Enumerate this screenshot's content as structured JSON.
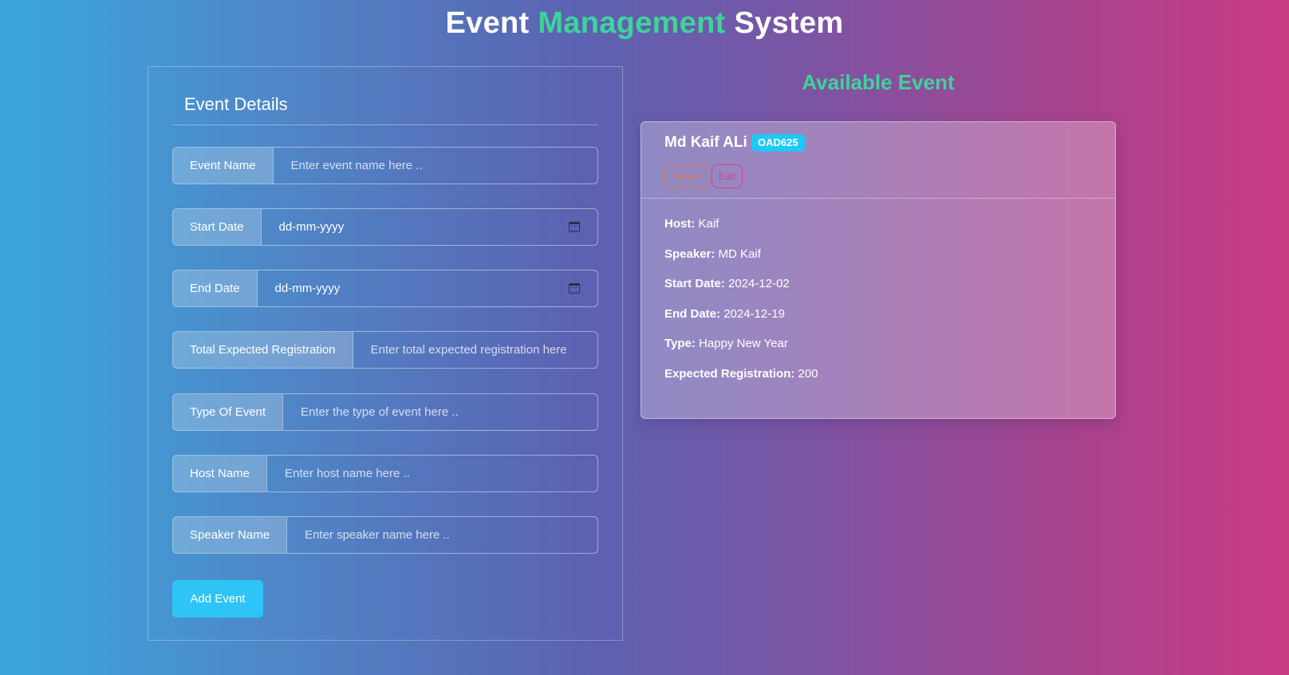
{
  "header": {
    "title_part1": "Event",
    "title_part2": "Management",
    "title_part3": "System"
  },
  "form": {
    "heading": "Event Details",
    "fields": {
      "event_name": {
        "label": "Event Name",
        "placeholder": "Enter event name here .."
      },
      "start_date": {
        "label": "Start Date",
        "value": "dd-mm-yyyy"
      },
      "end_date": {
        "label": "End Date",
        "value": "dd-mm-yyyy"
      },
      "total_registration": {
        "label": "Total Expected Registration",
        "placeholder": "Enter total expected registration here"
      },
      "type_of_event": {
        "label": "Type Of Event",
        "placeholder": "Enter the type of event here .."
      },
      "host_name": {
        "label": "Host Name",
        "placeholder": "Enter host name here .."
      },
      "speaker_name": {
        "label": "Speaker Name",
        "placeholder": "Enter speaker name here .."
      }
    },
    "submit_label": "Add Event"
  },
  "available": {
    "title": "Available Event",
    "card": {
      "name": "Md Kaif ALi",
      "badge": "OAD625",
      "delete_label": "Delete",
      "edit_label": "Edit",
      "host_label": "Host:",
      "host_value": "Kaif",
      "speaker_label": "Speaker:",
      "speaker_value": "MD Kaif",
      "start_label": "Start Date:",
      "start_value": "2024-12-02",
      "end_label": "End Date:",
      "end_value": "2024-12-19",
      "type_label": "Type:",
      "type_value": "Happy New Year",
      "registration_label": "Expected Registration:",
      "registration_value": "200"
    }
  },
  "colors": {
    "accent_green": "#3ed39a",
    "button_cyan": "#2ec4f5",
    "delete_orange": "#e8784a",
    "edit_pink": "#e03b87"
  }
}
